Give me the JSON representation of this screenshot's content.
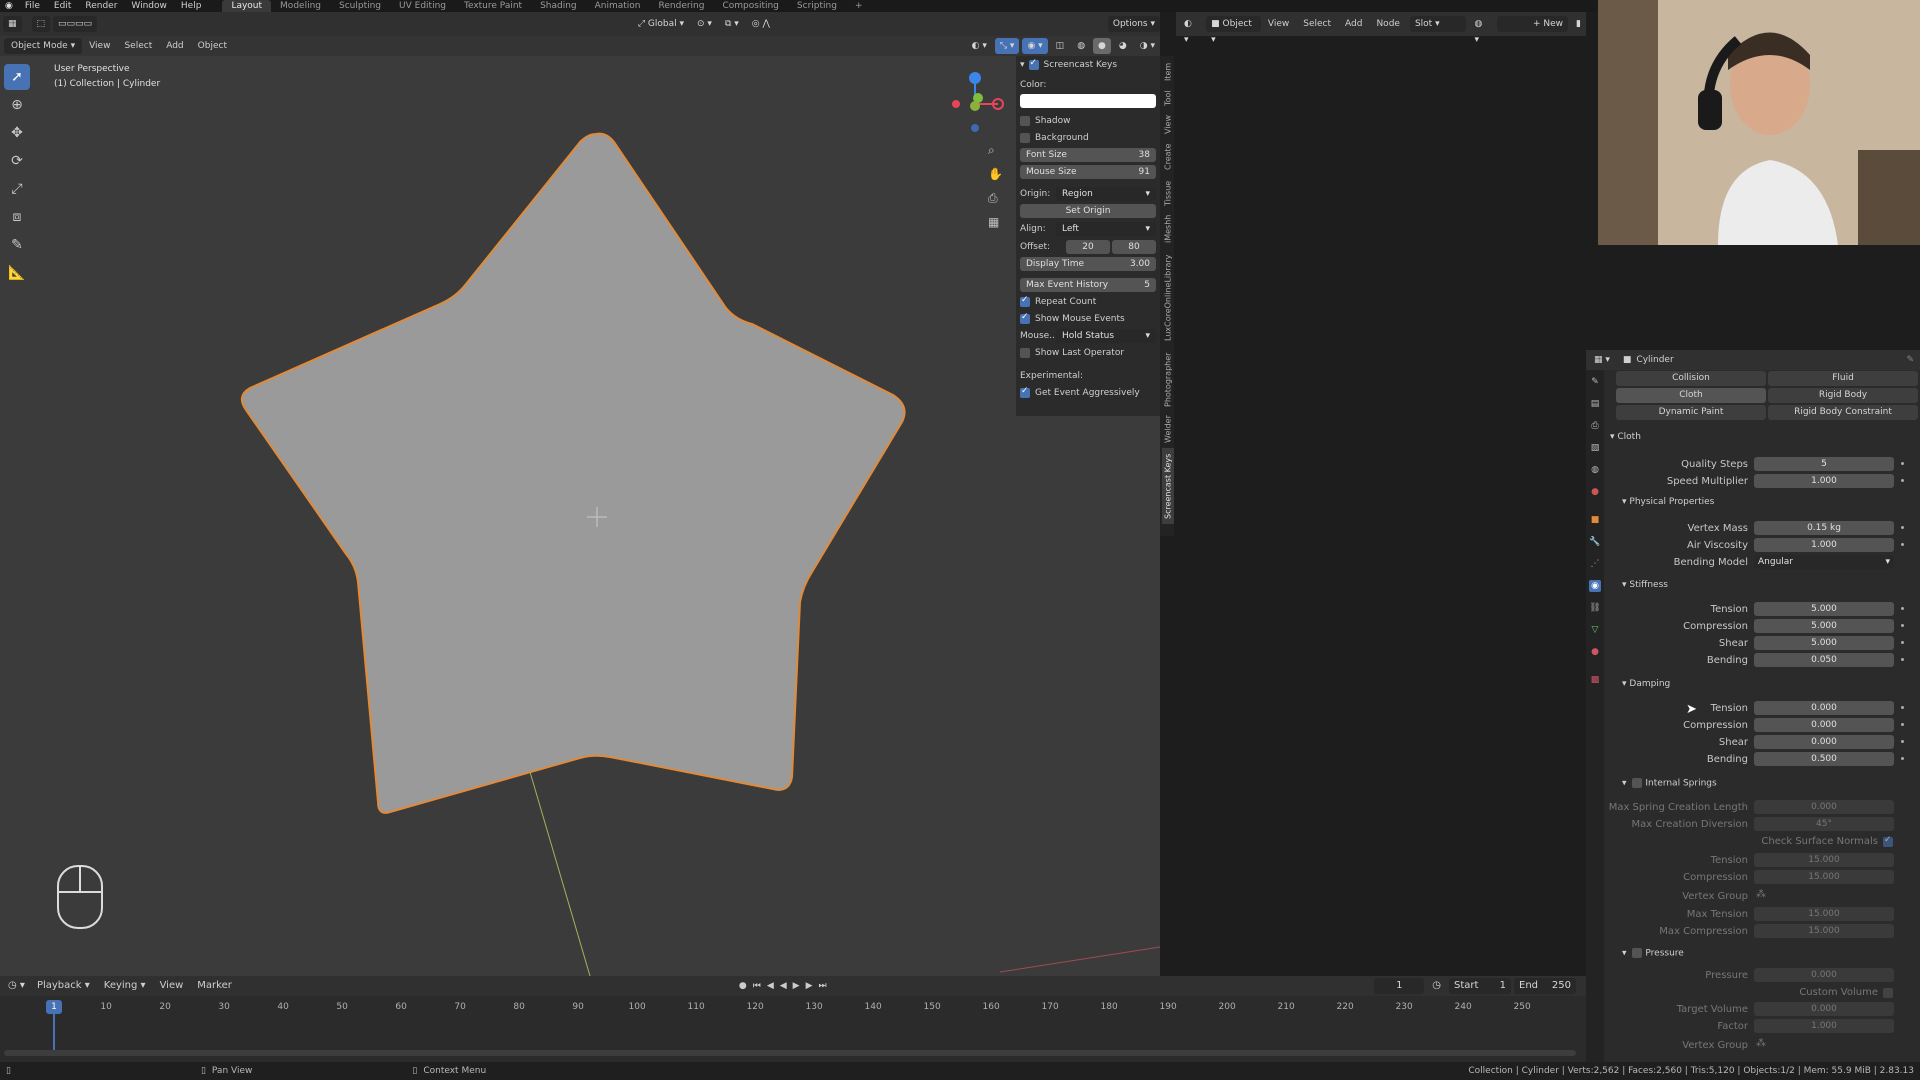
{
  "topbar": {
    "menus": [
      "File",
      "Edit",
      "Render",
      "Window",
      "Help"
    ],
    "workspaces": [
      "Layout",
      "Modeling",
      "Sculpting",
      "UV Editing",
      "Texture Paint",
      "Shading",
      "Animation",
      "Rendering",
      "Compositing",
      "Scripting"
    ],
    "active_workspace": "Layout",
    "add_tab": "+"
  },
  "viewport": {
    "header": {
      "transform": "Global",
      "options": "Options"
    },
    "mode": "Object Mode",
    "menus": [
      "View",
      "Select",
      "Add",
      "Object"
    ],
    "overlay_title": "User Perspective",
    "overlay_subtitle": "(1) Collection | Cylinder",
    "gizmo_axes": {
      "x_color": "#e8455a",
      "y_color": "#7fbf3b",
      "z_color": "#3b86e8"
    }
  },
  "screencast_panel": {
    "title": "Screencast Keys",
    "color_label": "Color:",
    "shadow_label": "Shadow",
    "background_label": "Background",
    "font_size_label": "Font Size",
    "font_size_value": "38",
    "mouse_size_label": "Mouse Size",
    "mouse_size_value": "91",
    "origin_label": "Origin:",
    "origin_value": "Region",
    "set_origin_label": "Set Origin",
    "align_label": "Align:",
    "align_value": "Left",
    "offset_label": "Offset:",
    "offset_x": "20",
    "offset_y": "80",
    "display_time_label": "Display Time",
    "display_time_value": "3.00",
    "max_event_label": "Max Event History",
    "max_event_value": "5",
    "repeat_count_label": "Repeat Count",
    "show_mouse_label": "Show Mouse Events",
    "mouse_label": "Mouse..",
    "mouse_value": "Hold Status",
    "show_last_op_label": "Show Last Operator",
    "experimental_label": "Experimental:",
    "get_event_label": "Get Event Aggressively"
  },
  "side_tabs": [
    "Item",
    "Tool",
    "View",
    "Create",
    "Tissue",
    "iMeshh",
    "LuxCoreOnlineLibrary",
    "Photographer",
    "Welder",
    "Screencast Keys"
  ],
  "node_editor": {
    "object_label": "Object",
    "menus": [
      "View",
      "Select",
      "Add",
      "Node"
    ],
    "slot_label": "Slot",
    "new_label": "New"
  },
  "properties": {
    "object_name": "Cylinder",
    "physics_buttons": [
      {
        "label": "Collision",
        "side": "left"
      },
      {
        "label": "Fluid",
        "side": "right"
      },
      {
        "label": "Cloth",
        "side": "left"
      },
      {
        "label": "Rigid Body",
        "side": "right"
      },
      {
        "label": "Dynamic Paint",
        "side": "left"
      },
      {
        "label": "Rigid Body Constraint",
        "side": "right"
      }
    ],
    "cloth_section": "Cloth",
    "quality_steps_label": "Quality Steps",
    "quality_steps_value": "5",
    "speed_multiplier_label": "Speed Multiplier",
    "speed_multiplier_value": "1.000",
    "physical_section": "Physical Properties",
    "vertex_mass_label": "Vertex Mass",
    "vertex_mass_value": "0.15 kg",
    "air_viscosity_label": "Air Viscosity",
    "air_viscosity_value": "1.000",
    "bending_model_label": "Bending Model",
    "bending_model_value": "Angular",
    "stiffness_section": "Stiffness",
    "stiffness": [
      {
        "label": "Tension",
        "value": "5.000"
      },
      {
        "label": "Compression",
        "value": "5.000"
      },
      {
        "label": "Shear",
        "value": "5.000"
      },
      {
        "label": "Bending",
        "value": "0.050"
      }
    ],
    "damping_section": "Damping",
    "damping": [
      {
        "label": "Tension",
        "value": "0.000"
      },
      {
        "label": "Compression",
        "value": "0.000"
      },
      {
        "label": "Shear",
        "value": "0.000"
      },
      {
        "label": "Bending",
        "value": "0.500"
      }
    ],
    "internal_springs_section": "Internal Springs",
    "internal_springs": [
      {
        "label": "Max Spring Creation Length",
        "value": "0.000"
      },
      {
        "label": "Max Creation Diversion",
        "value": "45°"
      }
    ],
    "check_surface_normals_label": "Check Surface Normals",
    "internal_springs_2": [
      {
        "label": "Tension",
        "value": "15.000"
      },
      {
        "label": "Compression",
        "value": "15.000"
      }
    ],
    "vertex_group_label": "Vertex Group",
    "internal_springs_3": [
      {
        "label": "Max Tension",
        "value": "15.000"
      },
      {
        "label": "Max Compression",
        "value": "15.000"
      }
    ],
    "pressure_section": "Pressure",
    "pressure_label": "Pressure",
    "pressure_value": "0.000",
    "custom_volume_label": "Custom Volume",
    "target_volume_label": "Target Volume",
    "target_volume_value": "0.000",
    "factor_label": "Factor",
    "factor_value": "1.000",
    "vertex_group_label2": "Vertex Group"
  },
  "timeline": {
    "menus": [
      "Playback",
      "Keying",
      "View",
      "Marker"
    ],
    "current_frame": "1",
    "start_label": "Start",
    "start_value": "1",
    "end_label": "End",
    "end_value": "250",
    "ticks": [
      "10",
      "20",
      "30",
      "40",
      "50",
      "60",
      "70",
      "80",
      "90",
      "100",
      "110",
      "120",
      "130",
      "140",
      "150",
      "160",
      "170",
      "180",
      "190",
      "200",
      "210",
      "220",
      "230",
      "240",
      "250"
    ],
    "indicator": "1"
  },
  "statusbar": {
    "pan_view": "Pan View",
    "context_menu": "Context Menu",
    "info": "Collection | Cylinder | Verts:2,562 | Faces:2,560 | Tris:5,120 | Objects:1/2 | Mem: 55.9 MiB | 2.83.13"
  },
  "colors": {
    "accent": "#4772b3",
    "selection_outline": "#e08a3a",
    "star_fill": "#9a9a9a"
  }
}
